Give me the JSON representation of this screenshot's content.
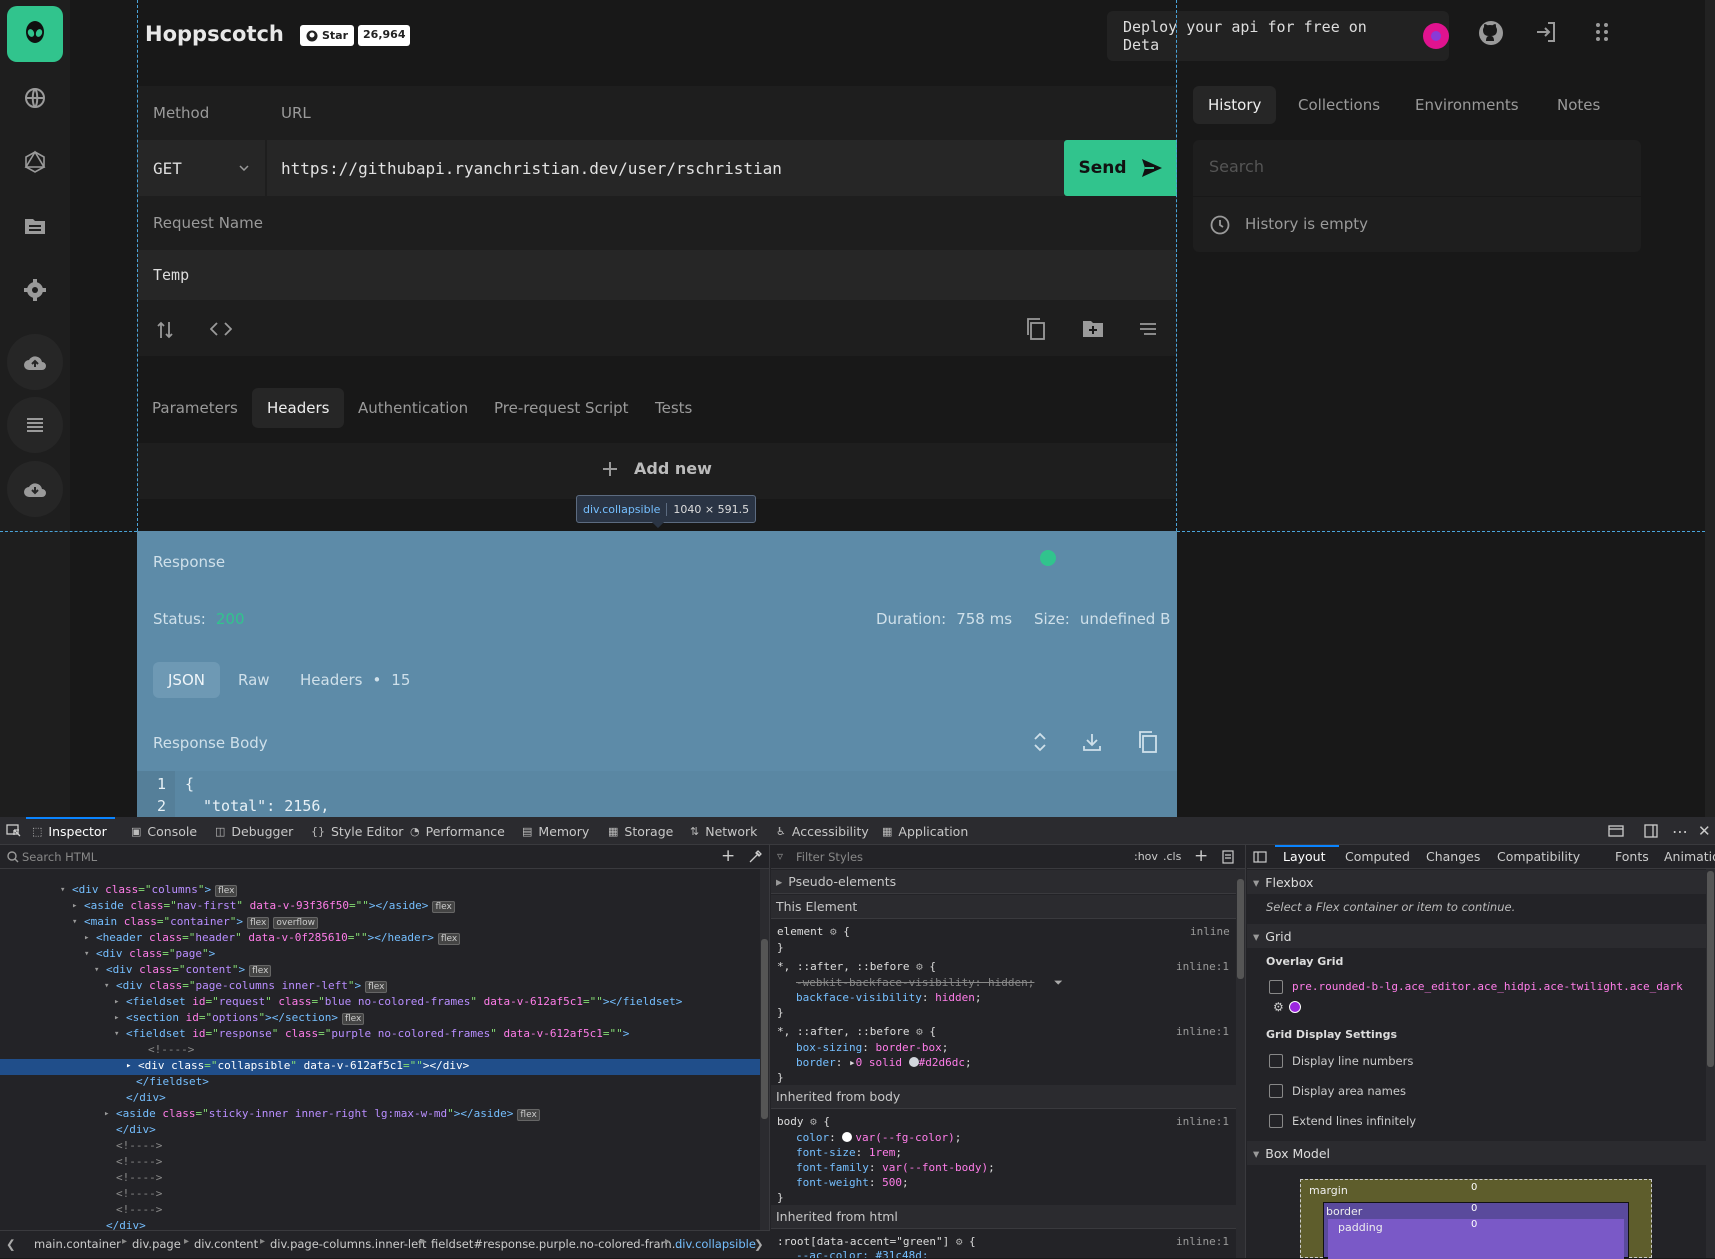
{
  "app": {
    "brand": "Hoppscotch",
    "github": {
      "star_label": "Star",
      "star_count": "26,964"
    },
    "deploy_text": "Deploy your api for free on Deta",
    "colors": {
      "accent": "#31c48d",
      "overlay": "#5d8ba8"
    },
    "request": {
      "method_label": "Method",
      "url_label": "URL",
      "method": "GET",
      "url": "https://githubapi.ryanchristian.dev/user/rschristian",
      "send_label": "Send",
      "name_label": "Request Name",
      "name_value": "Temp"
    },
    "tabs": [
      "Parameters",
      "Headers",
      "Authentication",
      "Pre-request Script",
      "Tests"
    ],
    "add_new": "Add new",
    "tooltip": {
      "selector": "div.collapsible",
      "size": "1040 × 591.5"
    },
    "response": {
      "title": "Response",
      "status_label": "Status:",
      "status_value": "200",
      "duration_label": "Duration:",
      "duration_value": "758 ms",
      "size_label": "Size:",
      "size_value": "undefined B",
      "tabs": {
        "json": "JSON",
        "raw": "Raw",
        "headers": "Headers",
        "headers_sep": "•",
        "headers_count": "15"
      },
      "body_label": "Response Body",
      "code": [
        {
          "ln": "1",
          "text": "{"
        },
        {
          "ln": "2",
          "text": "\"total\": 2156,"
        }
      ]
    },
    "sidepanel": {
      "tabs": [
        "History",
        "Collections",
        "Environments",
        "Notes"
      ],
      "search_placeholder": "Search",
      "empty": "History is empty"
    }
  },
  "devtools": {
    "tabs": [
      "Inspector",
      "Console",
      "Debugger",
      "Style Editor",
      "Performance",
      "Memory",
      "Storage",
      "Network",
      "Accessibility",
      "Application"
    ],
    "search_placeholder": "Search HTML",
    "tree": [
      {
        "open": "<",
        "tag": "div",
        "attrs": [
          [
            "class",
            "columns"
          ]
        ],
        "close": ">",
        "badge": "flex"
      },
      {
        "open": "<",
        "tag": "aside",
        "attrs": [
          [
            "class",
            "nav-first"
          ],
          [
            "data-v-93f36f50",
            ""
          ]
        ],
        "close": "></aside>",
        "badge": "flex"
      },
      {
        "open": "<",
        "tag": "main",
        "attrs": [
          [
            "class",
            "container"
          ]
        ],
        "close": ">",
        "badge": "flex",
        "badge2": "overflow"
      },
      {
        "open": "<",
        "tag": "header",
        "attrs": [
          [
            "class",
            "header"
          ],
          [
            "data-v-0f285610",
            ""
          ]
        ],
        "close": "></header>",
        "badge": "flex"
      },
      {
        "open": "<",
        "tag": "div",
        "attrs": [
          [
            "class",
            "page"
          ]
        ],
        "close": ">"
      },
      {
        "open": "<",
        "tag": "div",
        "attrs": [
          [
            "class",
            "content"
          ]
        ],
        "close": ">",
        "badge": "flex"
      },
      {
        "open": "<",
        "tag": "div",
        "attrs": [
          [
            "class",
            "page-columns inner-left"
          ]
        ],
        "close": ">",
        "badge": "flex"
      },
      {
        "open": "<",
        "tag": "fieldset",
        "attrs": [
          [
            "id",
            "request"
          ],
          [
            "class",
            "blue no-colored-frames"
          ],
          [
            "data-v-612af5c1",
            ""
          ]
        ],
        "close": "></fieldset>"
      },
      {
        "open": "<",
        "tag": "section",
        "attrs": [
          [
            "id",
            "options"
          ]
        ],
        "close": "></section>",
        "badge": "flex"
      },
      {
        "open": "<",
        "tag": "fieldset",
        "attrs": [
          [
            "id",
            "response"
          ],
          [
            "class",
            "purple no-colored-frames"
          ],
          [
            "data-v-612af5c1",
            ""
          ]
        ],
        "close": ">"
      },
      {
        "comment": "<!---->"
      },
      {
        "open": "<",
        "tag": "div",
        "attrs": [
          [
            "class",
            "collapsible"
          ],
          [
            "data-v-612af5c1",
            ""
          ]
        ],
        "close": "></div>",
        "selected": true
      },
      {
        "endtag": "</fieldset>"
      },
      {
        "endtag": "</div>"
      },
      {
        "open": "<",
        "tag": "aside",
        "attrs": [
          [
            "class",
            "sticky-inner inner-right lg:max-w-md"
          ]
        ],
        "close": "></aside>",
        "badge": "flex"
      },
      {
        "endtag": "</div>"
      },
      {
        "comment": "<!---->"
      },
      {
        "comment": "<!---->"
      },
      {
        "comment": "<!---->"
      },
      {
        "comment": "<!---->"
      },
      {
        "comment": "<!---->"
      },
      {
        "endtag": "</div>"
      }
    ],
    "breadcrumbs": [
      "main.container",
      "div.page",
      "div.content",
      "div.page-columns.inner-left",
      "fieldset#response.purple.no-colored-fram...",
      "div.collapsible"
    ],
    "rules": {
      "filter_placeholder": "Filter Styles",
      "hov": ":hov",
      "cls": ".cls",
      "pseudo": "Pseudo-elements",
      "this_element": "This Element",
      "element_sel": "element",
      "inline": "inline",
      "inline1": "inline:1",
      "rule1_sel": "*, ::after, ::before",
      "rule1_strike": "-webkit-backface-visibility: hidden;",
      "rule1_prop": "backface-visibility",
      "rule1_val": "hidden",
      "rule2_sel": "*, ::after, ::before",
      "rule2_p1": "box-sizing",
      "rule2_v1": "border-box",
      "rule2_p2": "border",
      "rule2_v2": "0 solid",
      "rule2_v2b": "#d2d6dc",
      "inherited_body": "Inherited from body",
      "body_sel": "body",
      "body_props": [
        [
          "color",
          "var(--fg-color)"
        ],
        [
          "font-size",
          "1rem"
        ],
        [
          "font-family",
          "var(--font-body)"
        ],
        [
          "font-weight",
          "500"
        ]
      ],
      "inherited_html": "Inherited from html",
      "root_sel": ":root[data-accent=\"green\"]",
      "root_partial": "--ac-color: #31c48d;"
    },
    "layout": {
      "tabs": [
        "Layout",
        "Computed",
        "Changes",
        "Compatibility",
        "Fonts",
        "Animation"
      ],
      "flexbox": "Flexbox",
      "flex_hint": "Select a Flex container or item to continue.",
      "grid": "Grid",
      "overlay_grid": "Overlay Grid",
      "grid_item": "pre.rounded-b-lg.ace_editor.ace_hidpi.ace-twilight.ace_dark",
      "display_settings": "Grid Display Settings",
      "options": [
        "Display line numbers",
        "Display area names",
        "Extend lines infinitely"
      ],
      "box_model": "Box Model",
      "margin": "margin",
      "border": "border",
      "padding": "padding",
      "zero": "0"
    }
  }
}
